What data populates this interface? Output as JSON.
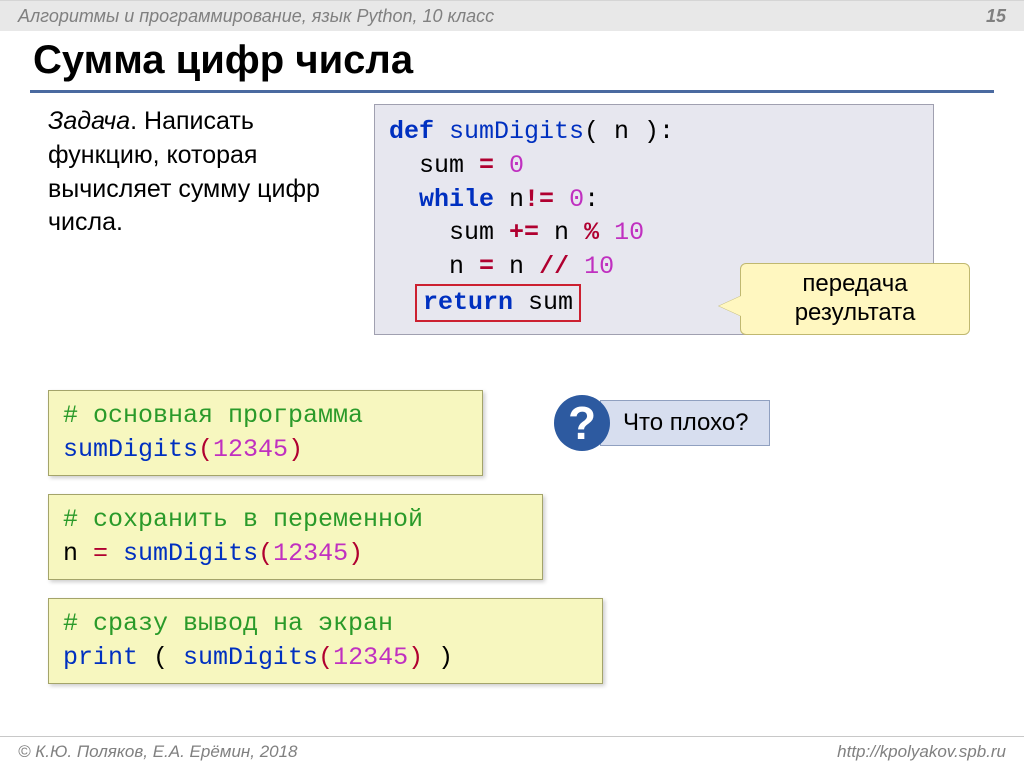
{
  "header": {
    "breadcrumb": "Алгоритмы и программирование, язык Python, 10 класс",
    "page": "15"
  },
  "title": "Сумма цифр числа",
  "task": {
    "label": "Задача",
    "text": ". Написать функцию, которая вычисляет сумму цифр числа."
  },
  "code_main": {
    "l1_def": "def",
    "l1_name": " sumDigits",
    "l1_rest": "( n ):",
    "l2a": "sum ",
    "l2eq": "=",
    "l2b": " 0",
    "l3_while": "while",
    "l3_rest": " n",
    "l3_op": "!=",
    "l3_num": " 0",
    "l3_colon": ":",
    "l4a": "sum ",
    "l4op": "+=",
    "l4b": " n ",
    "l4mod": "%",
    "l4num": " 10",
    "l5a": "n ",
    "l5eq": "=",
    "l5b": " n ",
    "l5div": "//",
    "l5num": " 10",
    "l6_ret": "return",
    "l6_rest": " sum"
  },
  "callout_result": {
    "line1": "передача",
    "line2": "результата"
  },
  "ybox1": {
    "comment": "# основная программа",
    "fn": "sumDigits",
    "open": "(",
    "arg": "12345",
    "close": ")"
  },
  "ybox2": {
    "comment": "# сохранить в переменной",
    "lhs": "n ",
    "eq": "=",
    "sp": " ",
    "fn": "sumDigits",
    "open": "(",
    "arg": "12345",
    "close": ")"
  },
  "ybox3": {
    "comment": "# сразу вывод на экран",
    "print": "print",
    "sp1": " ( ",
    "fn": "sumDigits",
    "open": "(",
    "arg": "12345",
    "close": ")",
    "sp2": " )"
  },
  "question": {
    "mark": "?",
    "text": "Что плохо?"
  },
  "footer": {
    "left": "© К.Ю. Поляков, Е.А. Ерёмин, 2018",
    "right": "http://kpolyakov.spb.ru"
  }
}
